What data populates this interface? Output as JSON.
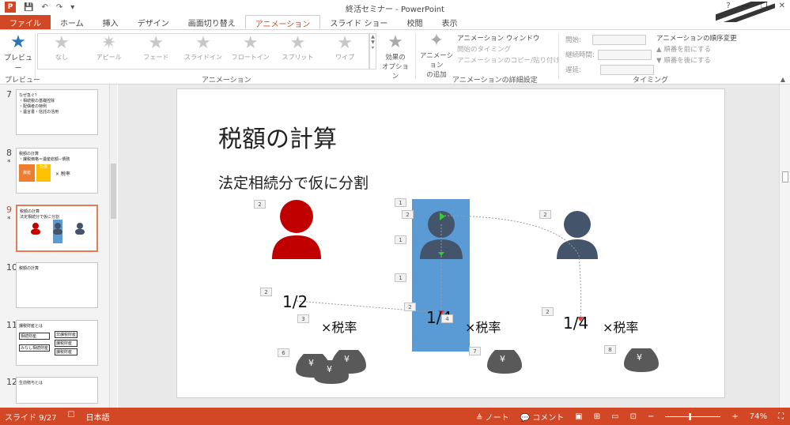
{
  "window": {
    "title": "終活セミナー - PowerPoint",
    "help": "?",
    "min": "—",
    "restore": "❐",
    "close": "✕"
  },
  "quick_access": {
    "logo": "P",
    "save": "💾",
    "undo": "↶",
    "redo": "↷",
    "customize": "▾"
  },
  "tabs": [
    {
      "label": "ファイル"
    },
    {
      "label": "ホーム"
    },
    {
      "label": "挿入"
    },
    {
      "label": "デザイン"
    },
    {
      "label": "画面切り替え"
    },
    {
      "label": "アニメーション"
    },
    {
      "label": "スライド ショー"
    },
    {
      "label": "校閲"
    },
    {
      "label": "表示"
    }
  ],
  "ribbon": {
    "preview": {
      "label": "プレビュー",
      "group": "プレビュー"
    },
    "gallery_group": "アニメーション",
    "animations": [
      "なし",
      "アピール",
      "フェード",
      "スライドイン",
      "フロートイン",
      "スプリット",
      "ワイプ"
    ],
    "effect_options": "効果の\nオプション",
    "add_animation": "アニメーション\nの追加",
    "advanced": {
      "group": "アニメーションの詳細設定",
      "pane": "アニメーション ウィンドウ",
      "trigger": "開始のタイミング",
      "painter": "アニメーションのコピー/貼り付け"
    },
    "timing": {
      "group": "タイミング",
      "start": "開始:",
      "duration": "継続時間:",
      "delay": "遅延:"
    },
    "order": {
      "title": "アニメーションの順序変更",
      "earlier": "▲ 順番を前にする",
      "later": "▼ 順番を後にする"
    }
  },
  "slides": [
    {
      "num": "7",
      "lines": [
        "なぜ急ぐ？",
        "・相続税の基礎控除",
        "・配偶者の特例",
        "・遺言書・信託の活用"
      ]
    },
    {
      "num": "8",
      "star": "*",
      "title": "税額の計算",
      "sub": "・課税価格＝遺産総額−債務",
      "boxes": [
        "資産",
        "負債"
      ],
      "rate": "× 税率"
    },
    {
      "num": "9",
      "star": "*",
      "title": "税額の計算",
      "sub": "法定相続分で仮に分割",
      "selected": true
    },
    {
      "num": "10",
      "title": "税額の計算"
    },
    {
      "num": "11",
      "title": "課税財産とは",
      "items": [
        "相続財産",
        "みなし相続財産",
        "非課税財産",
        "課税財産",
        "課税財産"
      ]
    },
    {
      "num": "12",
      "title": "生前贈与とは"
    }
  ],
  "slide": {
    "title": "税額の計算",
    "subtitle": "法定相続分で仮に分割",
    "fractions": [
      "1/2",
      "1/4",
      "1/4"
    ],
    "rates": [
      "×税率",
      "×税率",
      "×税率"
    ],
    "yen": "¥",
    "tags": {
      "t1": "2",
      "t2": "1",
      "t3": "2",
      "t4": "1",
      "t5": "1",
      "t6": "2",
      "t7": "2",
      "t8": "3",
      "t9": "2",
      "t10": "4",
      "t11": "2",
      "t12": "6",
      "t13": "7",
      "t14": "8",
      "t15": "2"
    }
  },
  "status": {
    "slide": "スライド 9/27",
    "lang": "日本語",
    "notes": "≜ ノート",
    "comments": "💬 コメント",
    "zoom": "74%",
    "minus": "−",
    "plus": "+"
  },
  "colors": {
    "accent": "#d24726",
    "red_person": "#c00000",
    "navy_person": "#44546a",
    "highlight": "#5b9bd5"
  }
}
